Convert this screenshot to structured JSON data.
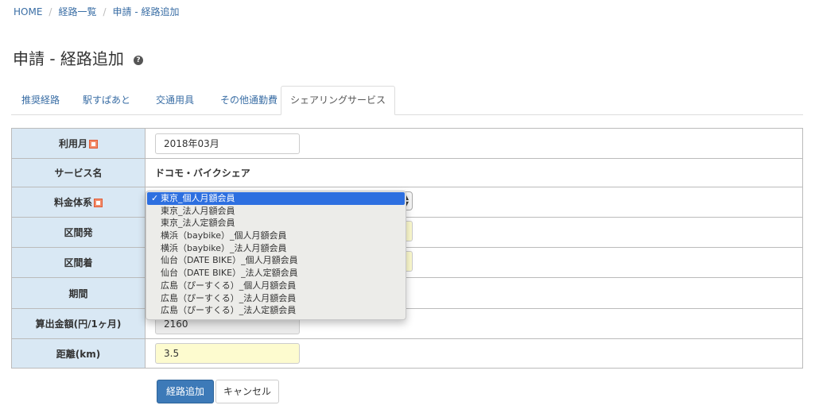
{
  "breadcrumb": [
    "HOME",
    "経路一覧",
    "申請 - 経路追加"
  ],
  "page_title": "申請 - 経路追加",
  "help_glyph": "?",
  "tabs": [
    "推奨経路",
    "駅すぱあと",
    "交通用具",
    "その他通勤費",
    "シェアリングサービス"
  ],
  "active_tab": "シェアリングサービス",
  "form": {
    "usage_month": {
      "label": "利用月",
      "value": "2018年03月"
    },
    "service_name": {
      "label": "サービス名",
      "value": "ドコモ・バイクシェア"
    },
    "fee_system": {
      "label": "料金体系",
      "selected": "東京_個人月額会員",
      "options": [
        "東京_個人月額会員",
        "東京_法人月額会員",
        "東京_法人定額会員",
        "横浜（baybike）_個人月額会員",
        "横浜（baybike）_法人月額会員",
        "仙台（DATE BIKE）_個人月額会員",
        "仙台（DATE BIKE）_法人定額会員",
        "広島（ぴーすくる）_個人月額会員",
        "広島（ぴーすくる）_法人月額会員",
        "広島（ぴーすくる）_法人定額会員"
      ]
    },
    "section_from": {
      "label": "区間発",
      "value": ""
    },
    "section_to": {
      "label": "区間着",
      "value": ""
    },
    "period": {
      "label": "期間",
      "value": ""
    },
    "amount": {
      "label": "算出金額(円/1ヶ月)",
      "value": "2160"
    },
    "distance": {
      "label": "距離(km)",
      "value": "3.5"
    }
  },
  "buttons": {
    "add_route": "経路追加",
    "cancel": "キャンセル"
  },
  "colors": {
    "label_bg": "#d9e8f4",
    "primary": "#3d7ab8",
    "link": "#3a6ea5",
    "highlight": "#2d6fe0",
    "input_yellow": "#fdfbcf"
  }
}
